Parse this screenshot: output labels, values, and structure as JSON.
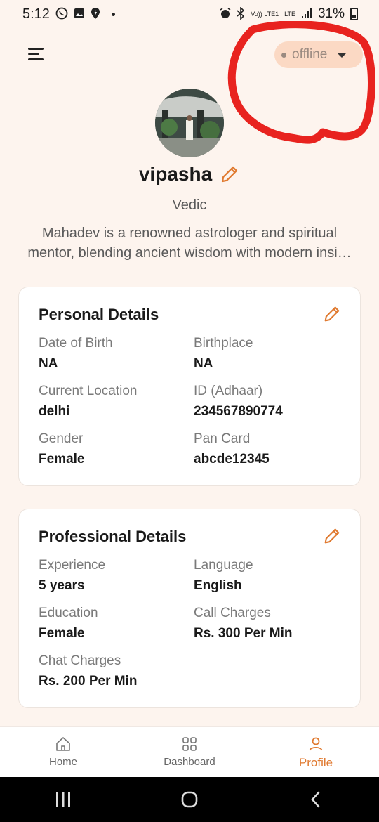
{
  "status_bar": {
    "time": "5:12",
    "battery": "31%",
    "volte": "Vo)) LTE1",
    "lte": "LTE"
  },
  "header": {
    "status_value": "offline",
    "status_dot_color": "#9a8a80"
  },
  "profile": {
    "name": "vipasha",
    "category": "Vedic",
    "bio_line1": "Mahadev is a renowned astrologer and spiritual",
    "bio_line2": "mentor, blending ancient wisdom with modern insi…"
  },
  "personal": {
    "title": "Personal Details",
    "fields": [
      {
        "label": "Date of Birth",
        "value": "NA"
      },
      {
        "label": "Birthplace",
        "value": "NA"
      },
      {
        "label": "Current Location",
        "value": "delhi"
      },
      {
        "label": "ID (Adhaar)",
        "value": "234567890774"
      },
      {
        "label": "Gender",
        "value": "Female"
      },
      {
        "label": "Pan Card",
        "value": "abcde12345"
      }
    ]
  },
  "professional": {
    "title": "Professional Details",
    "fields": [
      {
        "label": "Experience",
        "value": "5 years"
      },
      {
        "label": "Language",
        "value": "English"
      },
      {
        "label": "Education",
        "value": "Female"
      },
      {
        "label": "Call Charges",
        "value": "Rs. 300 Per Min"
      },
      {
        "label": "Chat Charges",
        "value": "Rs. 200 Per Min"
      }
    ]
  },
  "nav": {
    "items": [
      {
        "label": "Home",
        "icon": "home-icon"
      },
      {
        "label": "Dashboard",
        "icon": "dashboard-icon"
      },
      {
        "label": "Profile",
        "icon": "profile-icon"
      }
    ],
    "active": "Profile"
  },
  "colors": {
    "accent": "#e07a30",
    "background": "#fdf4ee",
    "pill": "#fbd9c4",
    "annotation": "#e8231f"
  }
}
